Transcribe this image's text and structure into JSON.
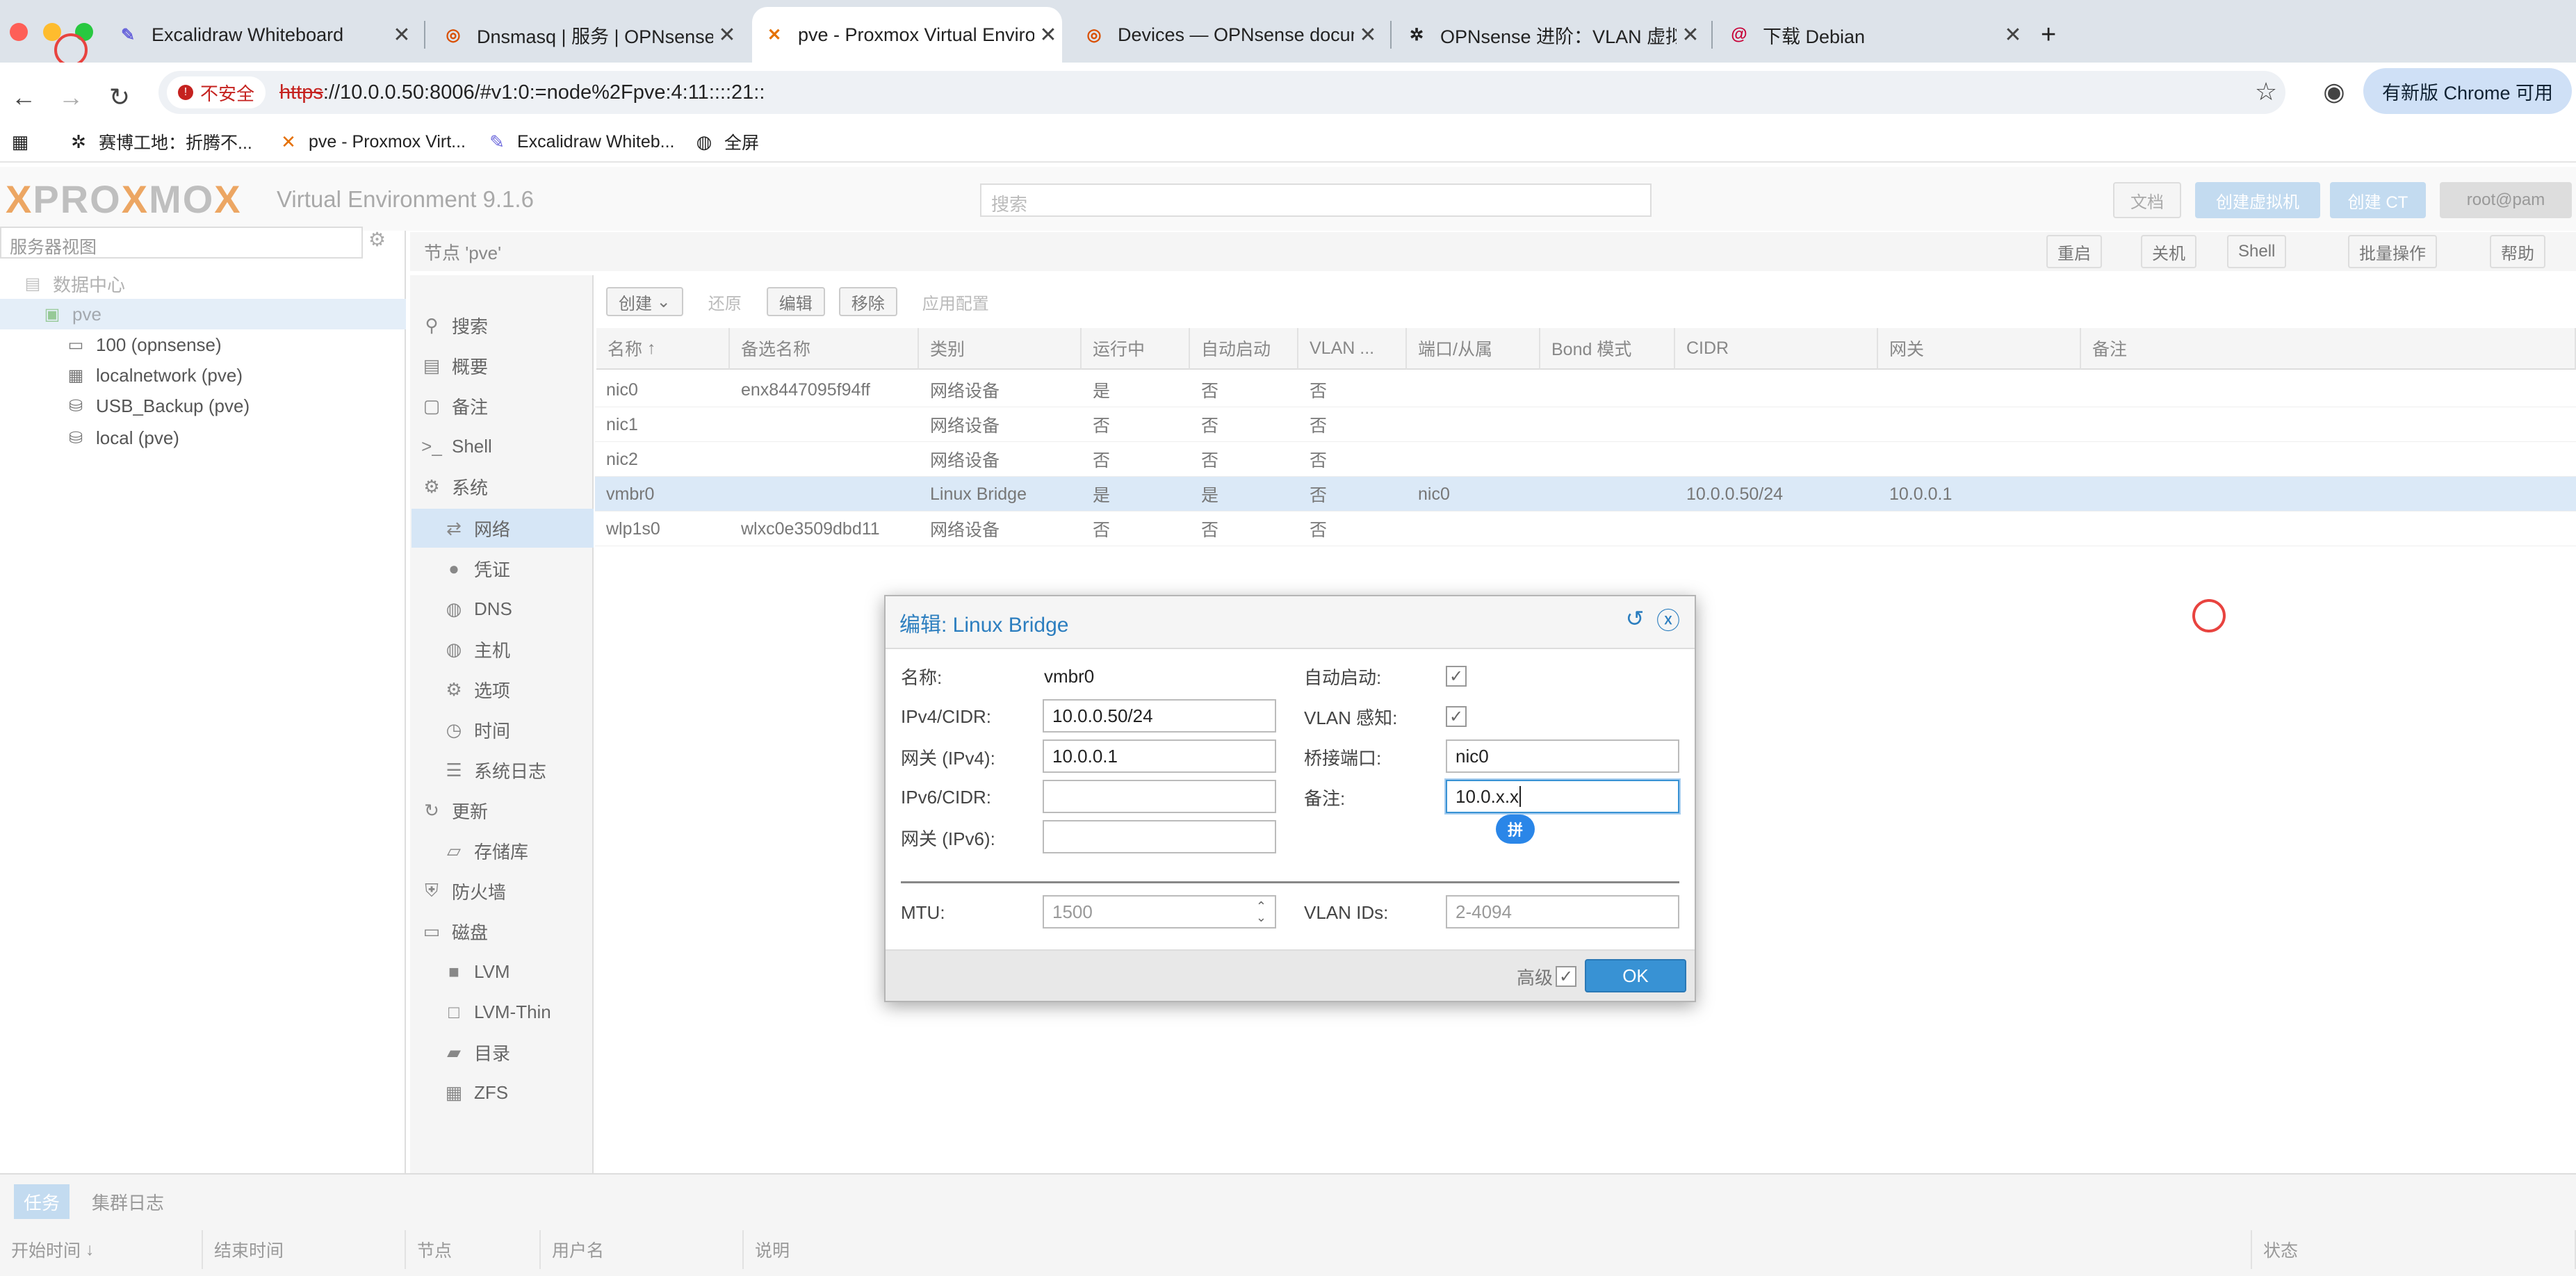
{
  "browser": {
    "tabs": [
      {
        "title": "Excalidraw Whiteboard",
        "icon": "excalidraw-icon"
      },
      {
        "title": "Dnsmasq | 服务 | OPNsense.ir",
        "icon": "opnsense-icon"
      },
      {
        "title": "pve - Proxmox Virtual Environm",
        "icon": "proxmox-icon"
      },
      {
        "title": "Devices — OPNsense docume",
        "icon": "opnsense-icon"
      },
      {
        "title": "OPNsense 进阶：VLAN 虚拟局",
        "icon": "gear-icon"
      },
      {
        "title": "下载 Debian",
        "icon": "debian-icon"
      }
    ],
    "new_tab": "+",
    "insecure_label": "不安全",
    "url_scheme": "https",
    "url_rest": "://10.0.0.50:8006/#v1:0:=node%2Fpve:4:11::::21::",
    "update_button": "有新版 Chrome 可用",
    "bookmarks": [
      {
        "label": "赛博工地：折腾不...",
        "icon": "gear-icon"
      },
      {
        "label": "pve - Proxmox Virt...",
        "icon": "proxmox-icon"
      },
      {
        "label": "Excalidraw Whiteb...",
        "icon": "excalidraw-icon"
      },
      {
        "label": "全屏",
        "icon": "globe-icon"
      }
    ]
  },
  "pve": {
    "logo": {
      "a": "PRO",
      "x": "X",
      "b": "MO",
      "y": "X"
    },
    "version": "Virtual Environment 9.1.6",
    "search_placeholder": "搜索",
    "header_buttons": [
      "文档",
      "创建虚拟机",
      "创建 CT",
      "root@pam"
    ],
    "view_selector": "服务器视图",
    "tree": [
      {
        "label": "数据中心",
        "icon": "datacenter-icon"
      },
      {
        "label": "pve",
        "icon": "server-icon"
      },
      {
        "label": "100 (opnsense)",
        "icon": "vm-icon"
      },
      {
        "label": "localnetwork (pve)",
        "icon": "network-grid-icon"
      },
      {
        "label": "USB_Backup (pve)",
        "icon": "storage-icon"
      },
      {
        "label": "local (pve)",
        "icon": "storage-icon"
      }
    ],
    "node_title": "节点 'pve'",
    "node_buttons": [
      "重启",
      "关机",
      "Shell",
      "批量操作",
      "帮助"
    ],
    "menu": [
      {
        "label": "搜索",
        "icon": "search-icon"
      },
      {
        "label": "概要",
        "icon": "summary-icon"
      },
      {
        "label": "备注",
        "icon": "notes-icon"
      },
      {
        "label": "Shell",
        "icon": "terminal-icon"
      },
      {
        "label": "系统",
        "icon": "gears-icon"
      },
      {
        "label": "网络",
        "icon": "network-icon"
      },
      {
        "label": "凭证",
        "icon": "certificate-icon"
      },
      {
        "label": "DNS",
        "icon": "globe-icon"
      },
      {
        "label": "主机",
        "icon": "globe-icon"
      },
      {
        "label": "选项",
        "icon": "gear-icon"
      },
      {
        "label": "时间",
        "icon": "clock-icon"
      },
      {
        "label": "系统日志",
        "icon": "list-icon"
      },
      {
        "label": "更新",
        "icon": "refresh-icon"
      },
      {
        "label": "存储库",
        "icon": "repository-icon"
      },
      {
        "label": "防火墙",
        "icon": "shield-icon"
      },
      {
        "label": "磁盘",
        "icon": "disk-icon"
      },
      {
        "label": "LVM",
        "icon": "square-icon"
      },
      {
        "label": "LVM-Thin",
        "icon": "square-outline-icon"
      },
      {
        "label": "目录",
        "icon": "folder-icon"
      },
      {
        "label": "ZFS",
        "icon": "grid-icon"
      }
    ],
    "toolbar": [
      "创建",
      "还原",
      "编辑",
      "移除",
      "应用配置"
    ],
    "columns": [
      "名称",
      "备选名称",
      "类别",
      "运行中",
      "自动启动",
      "VLAN ...",
      "端口/从属",
      "Bond 模式",
      "CIDR",
      "网关",
      "备注"
    ],
    "rows": [
      [
        "nic0",
        "enx8447095f94ff",
        "网络设备",
        "是",
        "否",
        "否",
        "",
        "",
        "",
        "",
        ""
      ],
      [
        "nic1",
        "",
        "网络设备",
        "否",
        "否",
        "否",
        "",
        "",
        "",
        "",
        ""
      ],
      [
        "nic2",
        "",
        "网络设备",
        "否",
        "否",
        "否",
        "",
        "",
        "",
        "",
        ""
      ],
      [
        "vmbr0",
        "",
        "Linux Bridge",
        "是",
        "是",
        "否",
        "nic0",
        "",
        "10.0.0.50/24",
        "10.0.0.1",
        ""
      ],
      [
        "wlp1s0",
        "wlxc0e3509dbd11",
        "网络设备",
        "否",
        "否",
        "否",
        "",
        "",
        "",
        "",
        ""
      ]
    ],
    "bottom_tabs": [
      "任务",
      "集群日志"
    ],
    "bottom_columns": [
      "开始时间",
      "结束时间",
      "节点",
      "用户名",
      "说明",
      "状态"
    ]
  },
  "dialog": {
    "title": "编辑: Linux Bridge",
    "name_label": "名称:",
    "name_value": "vmbr0",
    "ipv4_label": "IPv4/CIDR:",
    "ipv4_value": "10.0.0.50/24",
    "gw4_label": "网关 (IPv4):",
    "gw4_value": "10.0.0.1",
    "ipv6_label": "IPv6/CIDR:",
    "ipv6_value": "",
    "gw6_label": "网关 (IPv6):",
    "gw6_value": "",
    "autostart_label": "自动启动:",
    "autostart_checked": true,
    "vlan_aware_label": "VLAN 感知:",
    "vlan_aware_checked": true,
    "ports_label": "桥接端口:",
    "ports_value": "nic0",
    "comment_label": "备注:",
    "comment_value": "10.0.x.x",
    "ime_badge": "拼",
    "mtu_label": "MTU:",
    "mtu_value": "1500",
    "vlan_ids_label": "VLAN IDs:",
    "vlan_ids_value": "2-4094",
    "advanced_label": "高级",
    "ok_label": "OK"
  }
}
